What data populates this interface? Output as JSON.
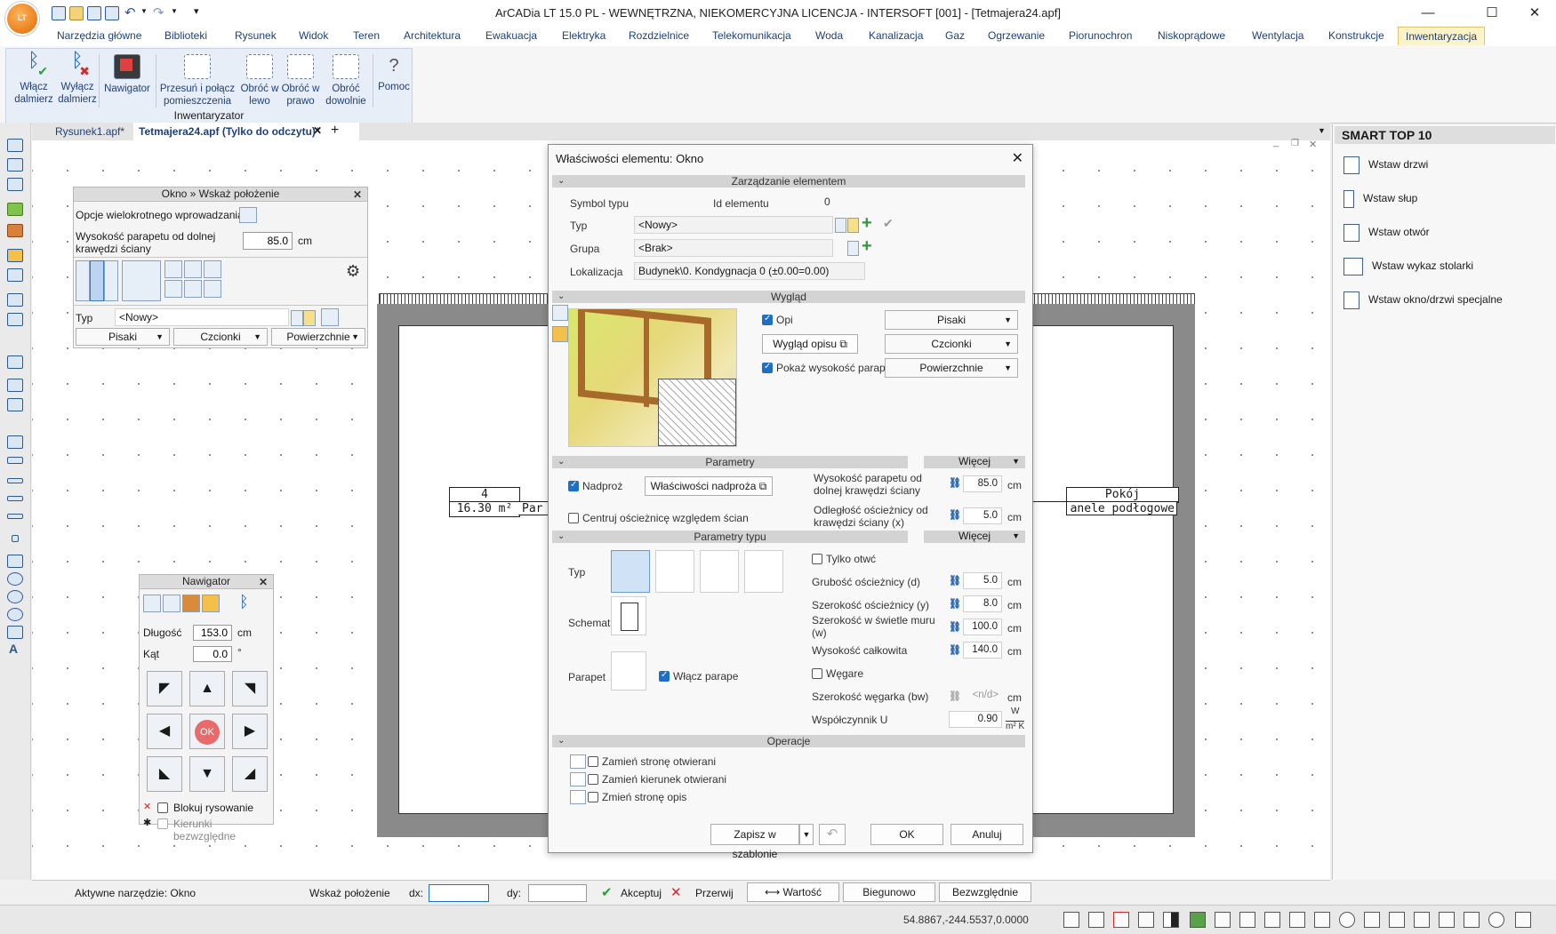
{
  "app": {
    "title": "ArCADia LT 15.0 PL - WEWNĘTRZNA, NIEKOMERCYJNA LICENCJA - INTERSOFT [001] - [Tetmajera24.apf]",
    "logo": "LT"
  },
  "window_controls": {
    "minimize": "—",
    "maximize": "☐",
    "close": "✕"
  },
  "ribbon_tabs": [
    "Narzędzia główne",
    "Biblioteki",
    "Rysunek",
    "Widok",
    "Teren",
    "Architektura",
    "Ewakuacja",
    "Elektryka",
    "Rozdzielnice",
    "Telekomunikacja",
    "Woda",
    "Kanalizacja",
    "Gaz",
    "Ogrzewanie",
    "Piorunochron",
    "Niskoprądowe",
    "Wentylacja",
    "Konstrukcje",
    "Inwentaryzacja"
  ],
  "ribbon_active_tab": "Inwentaryzacja",
  "ribbon_buttons": [
    {
      "label": "Włącz dalmierz",
      "icon": "bluetooth-on-icon"
    },
    {
      "label": "Wyłącz dalmierz",
      "icon": "bluetooth-off-icon"
    },
    {
      "label": "Nawigator",
      "icon": "navigator-icon"
    },
    {
      "label": "Przesuń i połącz pomieszczenia",
      "icon": "move-join-rooms-icon"
    },
    {
      "label": "Obróć w lewo",
      "icon": "rotate-left-icon"
    },
    {
      "label": "Obróć w prawo",
      "icon": "rotate-right-icon"
    },
    {
      "label": "Obróć dowolnie",
      "icon": "rotate-free-icon"
    },
    {
      "label": "Pomoc",
      "icon": "help-icon"
    }
  ],
  "ribbon_group_label": "Inwentaryzator",
  "doc_tabs": [
    {
      "label": "Rysunek1.apf*"
    },
    {
      "label": "Tetmajera24.apf (Tylko do odczytu)*",
      "active": true
    }
  ],
  "window_panel": {
    "title": "Okno » Wskaż położenie",
    "multi_input_label": "Opcje wielokrotnego wprowadzania",
    "sill_height_label": "Wysokość parapetu od dolnej krawędzi ściany",
    "sill_height_value": "85.0",
    "sill_unit": "cm",
    "type_label": "Typ",
    "type_value": "<Nowy>",
    "buttons": [
      "Pisaki",
      "Czcionki",
      "Powierzchnie"
    ]
  },
  "room_table": {
    "number": "4",
    "area": "16.30 m²",
    "cut_text": "Par",
    "name": "Pokój",
    "floor": "anele podłogowe"
  },
  "navigator": {
    "title": "Nawigator",
    "length_label": "Długość",
    "length_value": "153.0",
    "length_unit": "cm",
    "angle_label": "Kąt",
    "angle_value": "0.0",
    "angle_unit": "°",
    "ok_label": "OK",
    "block_label": "Blokuj rysowanie",
    "absolute_label": "Kierunki bezwzględne"
  },
  "dialog": {
    "title": "Właściwości elementu: Okno",
    "sections": {
      "management": "Zarządzanie elementem",
      "appearance": "Wygląd",
      "parameters": "Parametry",
      "type_parameters": "Parametry typu",
      "operations": "Operacje"
    },
    "more_label": "Więcej",
    "management": {
      "symbol_label": "Symbol typu",
      "id_label": "Id elementu",
      "id_value": "0",
      "type_label": "Typ",
      "type_value": "<Nowy>",
      "group_label": "Grupa",
      "group_value": "<Brak>",
      "location_label": "Lokalizacja",
      "location_value": "Budynek\\0. Kondygnacja 0 (±0.00=0.00)"
    },
    "appearance": {
      "opis_label": "Opi",
      "opis_checked": true,
      "desc_look_label": "Wygląd opisu",
      "show_sill_label": "Pokaż wysokość parapet",
      "show_sill_checked": true,
      "dropdowns": [
        "Pisaki",
        "Czcionki",
        "Powierzchnie"
      ]
    },
    "parameters": {
      "lintel_label": "Nadproż",
      "lintel_checked": true,
      "lintel_props_label": "Właściwości nadproża",
      "center_label": "Centruj ościeżnicę względem ścian",
      "center_checked": false,
      "sill_label": "Wysokość parapetu od dolnej krawędzi ściany",
      "sill_value": "85.0",
      "offset_label": "Odległość ościeżnicy od krawędzi ściany (x)",
      "offset_value": "5.0",
      "unit": "cm"
    },
    "type_params": {
      "type_label": "Typ",
      "scheme_label": "Schemat",
      "sill_label": "Parapet",
      "sill_enable_label": "Włącz parape",
      "sill_enable_checked": true,
      "only_opening_label": "Tylko otwć",
      "only_opening_checked": false,
      "frame_thickness_label": "Grubość ościeżnicy (d)",
      "frame_thickness_value": "5.0",
      "frame_width_label": "Szerokość ościeżnicy (y)",
      "frame_width_value": "8.0",
      "clear_width_label": "Szerokość w świetle muru (w)",
      "clear_width_value": "100.0",
      "total_height_label": "Wysokość całkowita",
      "total_height_value": "140.0",
      "reveals_label": "Węgare",
      "reveals_checked": false,
      "reveal_width_label": "Szerokość węgarka (bw)",
      "reveal_width_value": "<n/d>",
      "u_label": "Współczynnik U",
      "u_value": "0.90",
      "u_unit_top": "W",
      "u_unit_bottom": "m² K",
      "unit": "cm"
    },
    "operations": [
      {
        "label": "Zamień stronę otwierani",
        "checked": false
      },
      {
        "label": "Zamień kierunek otwierani",
        "checked": false
      },
      {
        "label": "Zmień stronę opis",
        "checked": false
      }
    ],
    "footer": {
      "template_label": "Zapisz w szablonie",
      "ok_label": "OK",
      "cancel_label": "Anuluj"
    }
  },
  "smart_panel": {
    "title": "SMART TOP 10",
    "items": [
      "Wstaw drzwi",
      "Wstaw słup",
      "Wstaw otwór",
      "Wstaw wykaz stolarki",
      "Wstaw okno/drzwi specjalne"
    ]
  },
  "command_bar": {
    "active_tool": "Aktywne narzędzie: Okno",
    "prompt": "Wskaż położenie",
    "dx_label": "dx:",
    "dx_value": "",
    "dy_label": "dy:",
    "dy_value": "",
    "accept_label": "Akceptuj",
    "interrupt_label": "Przerwij",
    "value_label": "Wartość",
    "polar_label": "Biegunowo",
    "absolute_label": "Bezwzględnie"
  },
  "status": {
    "coordinates": "54.8867,-244.5537,0.0000"
  },
  "colors": {
    "accent": "#1f6fc6",
    "ribbon_active": "#fdf3c9",
    "ok_button": "#e86a6a"
  }
}
